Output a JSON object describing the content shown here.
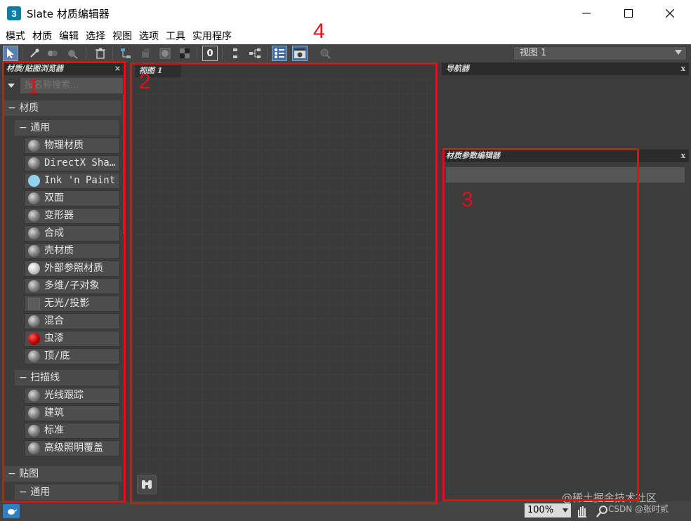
{
  "window": {
    "title": "Slate 材质编辑器",
    "icon_letter": "3"
  },
  "menu": [
    "模式",
    "材质",
    "编辑",
    "选择",
    "视图",
    "选项",
    "工具",
    "实用程序"
  ],
  "toolbar": {
    "view_select_value": "视图 1",
    "material_id_value": "0"
  },
  "browser": {
    "title": "材质/贴图浏览器",
    "close_label": "×",
    "search_placeholder": "按名称搜索...",
    "sections": {
      "materials": {
        "label": "材质"
      },
      "general": {
        "label": "通用"
      },
      "scanline": {
        "label": "扫描线"
      },
      "maps": {
        "label": "贴图"
      },
      "maps_general": {
        "label": "通用"
      }
    },
    "general_items": [
      "物理材质",
      "DirectX Sha…",
      "Ink 'n Paint",
      "双面",
      "变形器",
      "合成",
      "壳材质",
      "外部参照材质",
      "多维/子对象",
      "无光/投影",
      "混合",
      "虫漆",
      "顶/底"
    ],
    "scanline_items": [
      "光线跟踪",
      "建筑",
      "标准",
      "高级照明覆盖"
    ]
  },
  "view": {
    "tab_label": "视图 1"
  },
  "navigator": {
    "title": "导航器",
    "close_label": "x"
  },
  "param_editor": {
    "title": "材质参数编辑器",
    "close_label": "x"
  },
  "status": {
    "zoom": "100%"
  },
  "watermark": {
    "line1": "@稀土掘金技术社区",
    "line2": "CSDN @张时贰"
  },
  "annotations": {
    "a1": "1",
    "a2": "2",
    "a3": "3",
    "a4": "4"
  },
  "colors": {
    "highlight": "#e0101a",
    "panel": "#3c3c3c",
    "toolbar": "#444444"
  }
}
